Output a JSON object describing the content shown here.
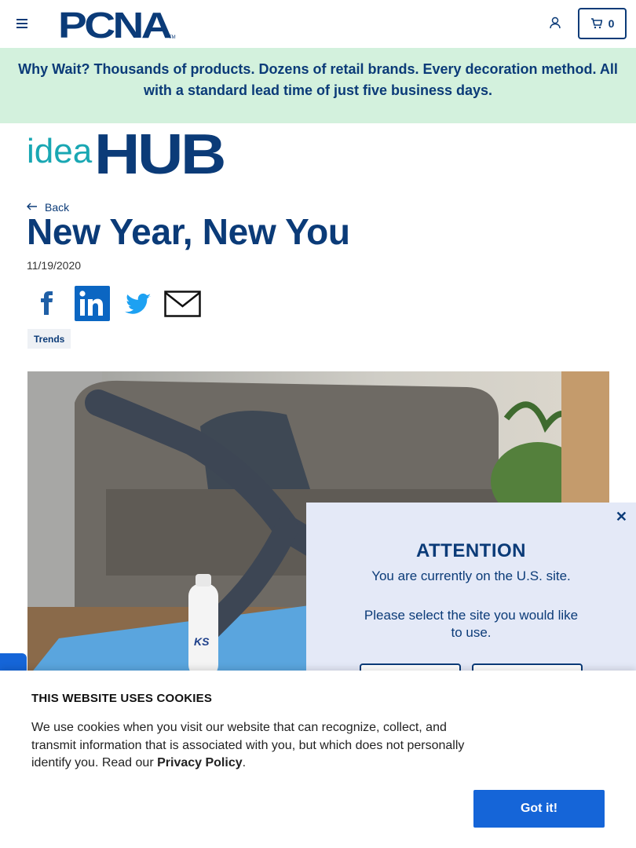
{
  "header": {
    "logo_text": "PCNA",
    "cart_count": "0"
  },
  "banner": {
    "text": "Why Wait? Thousands of products. Dozens of retail brands. Every decoration method. All with a standard lead time of just five business days."
  },
  "section_logo": {
    "part1": "idea",
    "part2": "HUB"
  },
  "article": {
    "back_label": "Back",
    "title": "New Year, New You",
    "date": "11/19/2020",
    "tag": "Trends"
  },
  "share_icons": [
    "facebook-icon",
    "linkedin-icon",
    "twitter-icon",
    "email-icon"
  ],
  "site_popup": {
    "heading": "ATTENTION",
    "message": "You are currently on the U.S. site.",
    "prompt": "Please select the site you would like to use."
  },
  "cookie_banner": {
    "heading": "THIS WEBSITE USES COOKIES",
    "body": "We use cookies when you visit our website that can recognize, collect, and transmit information that is associated with you, but which does not personally identify you. Read our ",
    "link": "Privacy Policy",
    "end": ".",
    "button": "Got it!"
  },
  "colors": {
    "brand": "#0b3b78",
    "accent": "#1565d8",
    "banner_bg": "#d3f1dd",
    "idea_teal": "#19a7b3"
  }
}
